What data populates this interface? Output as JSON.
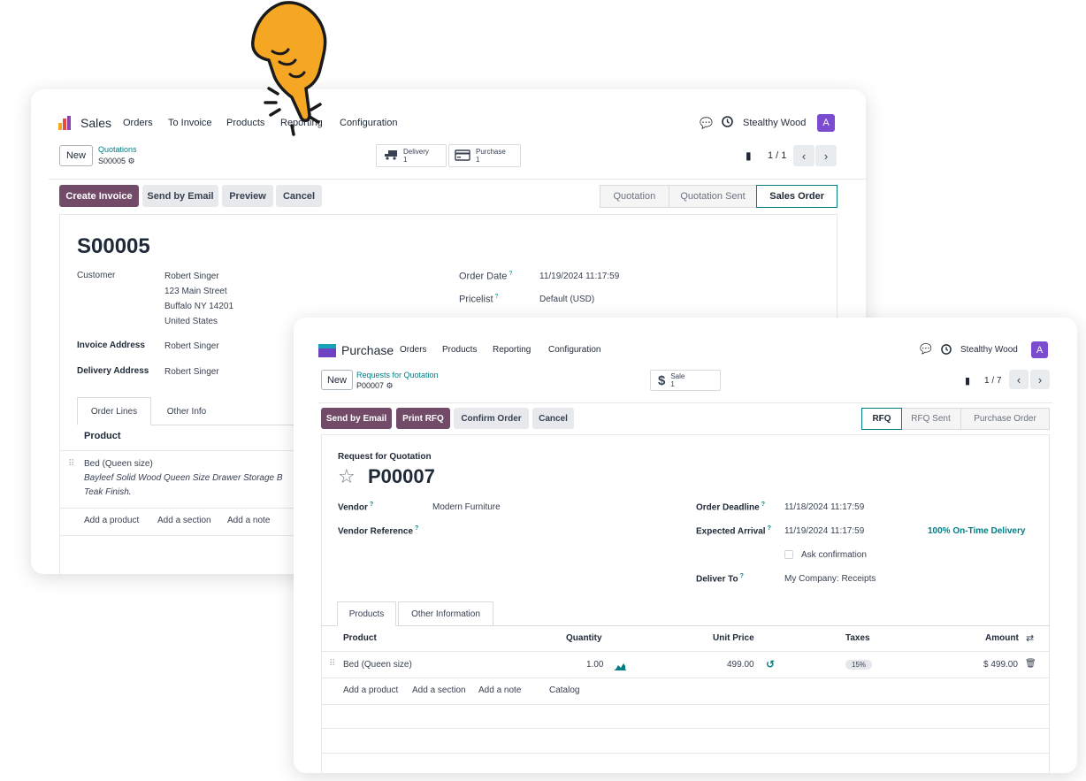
{
  "sales": {
    "app_name": "Sales",
    "menu": [
      "Orders",
      "To Invoice",
      "Products",
      "Reporting",
      "Configuration"
    ],
    "user": "Stealthy Wood",
    "avatar_letter": "A",
    "new_label": "New",
    "breadcrumb": "Quotations",
    "record_ref": "S00005",
    "smart_buttons": [
      {
        "label": "Delivery",
        "count": "1"
      },
      {
        "label": "Purchase",
        "count": "1"
      }
    ],
    "pager": "1 / 1",
    "actions": [
      "Create Invoice",
      "Send by Email",
      "Preview",
      "Cancel"
    ],
    "statusbar": [
      "Quotation",
      "Quotation Sent",
      "Sales Order"
    ],
    "title": "S00005",
    "customer_label": "Customer",
    "customer_name": "Robert Singer",
    "address_lines": [
      "123 Main Street",
      "Buffalo NY 14201",
      "United States"
    ],
    "invoice_address_label": "Invoice Address",
    "invoice_address": "Robert Singer",
    "delivery_address_label": "Delivery Address",
    "delivery_address": "Robert Singer",
    "order_date_label": "Order Date",
    "order_date": "11/19/2024 11:17:59",
    "pricelist_label": "Pricelist",
    "pricelist": "Default (USD)",
    "tabs": [
      "Order Lines",
      "Other Info"
    ],
    "col_product": "Product",
    "line_product": "Bed (Queen size)",
    "line_desc_1": "Bayleef Solid Wood Queen Size Drawer Storage B",
    "line_desc_2": "Teak Finish.",
    "add_links": [
      "Add a product",
      "Add a section",
      "Add a note"
    ]
  },
  "purchase": {
    "app_name": "Purchase",
    "menu": [
      "Orders",
      "Products",
      "Reporting",
      "Configuration"
    ],
    "user": "Stealthy Wood",
    "avatar_letter": "A",
    "new_label": "New",
    "breadcrumb": "Requests for Quotation",
    "record_ref": "P00007",
    "smart_button": {
      "label": "Sale",
      "count": "1"
    },
    "pager": "1 / 7",
    "actions": [
      "Send by Email",
      "Print RFQ",
      "Confirm Order",
      "Cancel"
    ],
    "statusbar": [
      "RFQ",
      "RFQ Sent",
      "Purchase Order"
    ],
    "subtitle": "Request for Quotation",
    "title": "P00007",
    "vendor_label": "Vendor",
    "vendor": "Modern Furniture",
    "vendor_ref_label": "Vendor Reference",
    "order_deadline_label": "Order Deadline",
    "order_deadline": "11/18/2024 11:17:59",
    "expected_arrival_label": "Expected Arrival",
    "expected_arrival": "11/19/2024 11:17:59",
    "on_time": "100% On-Time Delivery",
    "ask_confirmation": "Ask confirmation",
    "deliver_to_label": "Deliver To",
    "deliver_to": "My Company: Receipts",
    "tabs": [
      "Products",
      "Other Information"
    ],
    "columns": [
      "Product",
      "Quantity",
      "Unit Price",
      "Taxes",
      "Amount"
    ],
    "line": {
      "product": "Bed (Queen size)",
      "quantity": "1.00",
      "unit_price": "499.00",
      "tax": "15%",
      "amount": "$ 499.00"
    },
    "add_links": [
      "Add a product",
      "Add a section",
      "Add a note",
      "Catalog"
    ]
  },
  "colors": {
    "primary": "#714b67",
    "teal": "#017e84",
    "avatar": "#7b4ccf",
    "pointer": "#f5a623"
  }
}
